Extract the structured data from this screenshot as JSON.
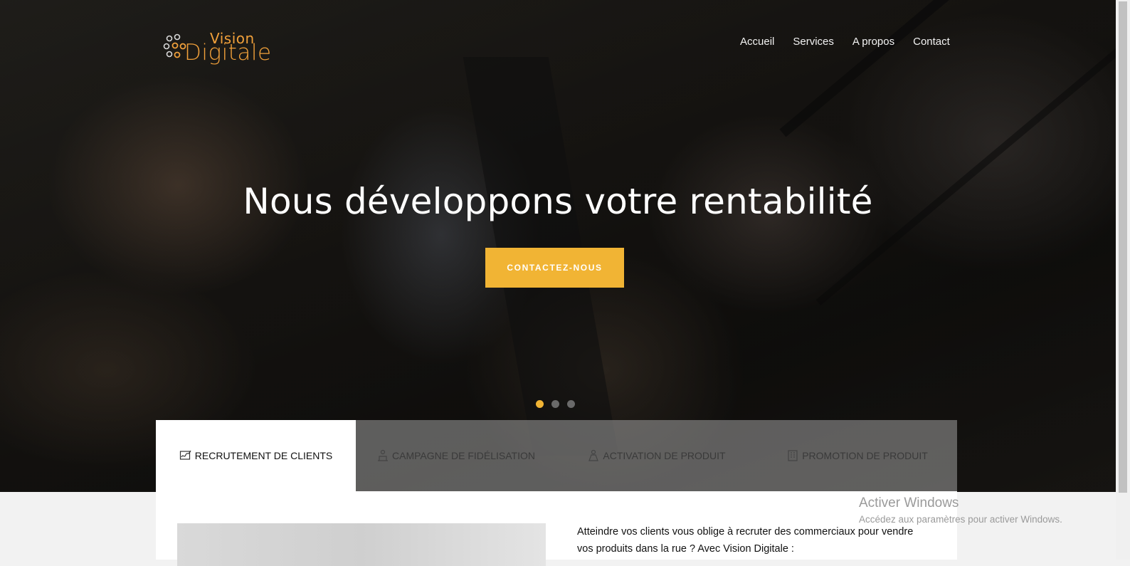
{
  "brand": {
    "line1": "Vision",
    "line2": "Digitale",
    "color": "#f0a03a"
  },
  "nav": {
    "items": [
      "Accueil",
      "Services",
      "A propos",
      "Contact"
    ]
  },
  "hero": {
    "headline": "Nous développons votre rentabilité",
    "cta_label": "CONTACTEZ-NOUS",
    "accent": "#f1b434",
    "slides_total": 3,
    "active_slide": 1
  },
  "tabs": [
    {
      "label": "RECRUTEMENT DE CLIENTS",
      "icon": "signature-icon",
      "active": true
    },
    {
      "label": "CAMPAGNE DE FIDÉLISATION",
      "icon": "team-icon",
      "active": false
    },
    {
      "label": "ACTIVATION DE PRODUIT",
      "icon": "product-icon",
      "active": false
    },
    {
      "label": "PROMOTION DE PRODUIT",
      "icon": "building-icon",
      "active": false
    }
  ],
  "content": {
    "paragraph": "Atteindre vos clients vous oblige à recruter des commerciaux pour vendre vos produits dans la rue ? Avec Vision Digitale :"
  },
  "watermark": {
    "title": "Activer Windows",
    "subtitle": "Accédez aux paramètres pour activer Windows."
  }
}
